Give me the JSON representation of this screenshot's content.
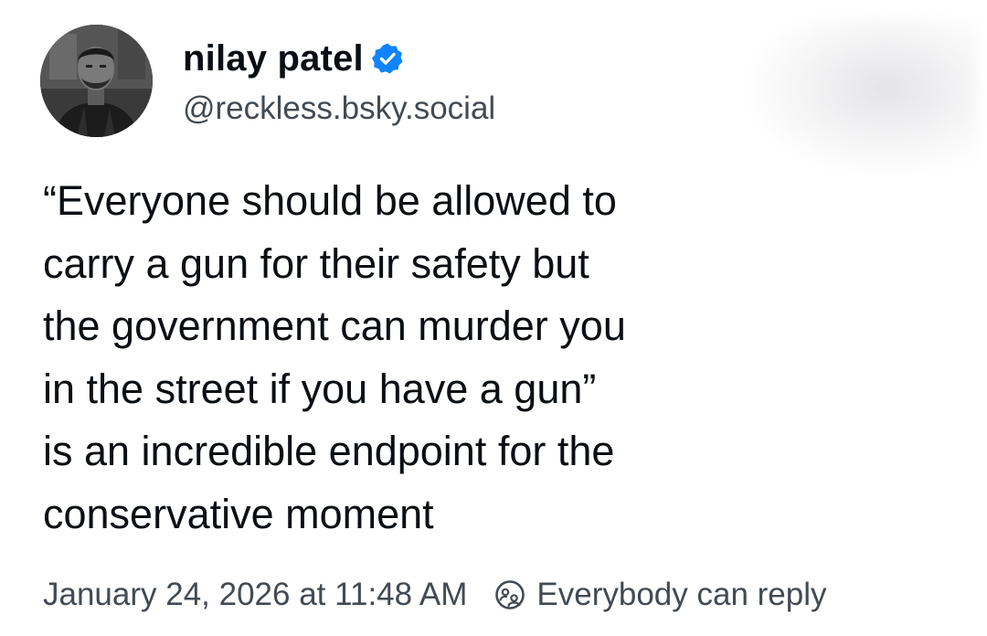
{
  "author": {
    "display_name": "nilay patel",
    "handle": "@reckless.bsky.social",
    "verified_icon": "verified-badge-icon",
    "avatar_icon": "avatar-photo"
  },
  "post": {
    "lines": [
      "“Everyone should be allowed to",
      "carry a gun for their safety but",
      "the government can murder you",
      "in the street if you have a gun”",
      "is an incredible endpoint for the",
      "conservative moment"
    ]
  },
  "meta": {
    "timestamp": "January 24, 2026 at 11:48 AM",
    "reply_setting": "Everybody can reply",
    "reply_icon": "everybody-reply-icon"
  },
  "colors": {
    "verified_blue": "#1083fe",
    "secondary_text": "#424a53",
    "primary_text": "#0b0f14"
  }
}
